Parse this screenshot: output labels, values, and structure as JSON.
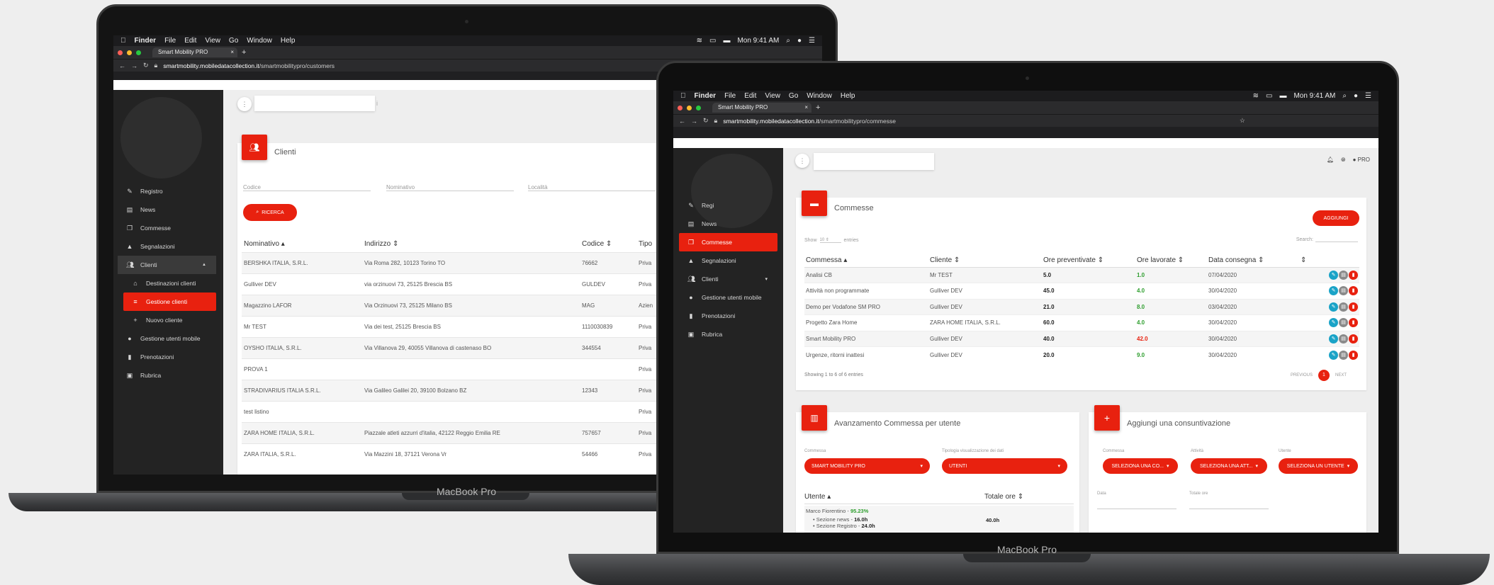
{
  "colors": {
    "accent": "#e8210f",
    "sidebar": "#232323",
    "green": "#2e9e2e"
  },
  "menubar": {
    "apple": "",
    "items": [
      "Finder",
      "File",
      "Edit",
      "View",
      "Go",
      "Window",
      "Help"
    ],
    "clock": "Mon 9:41 AM"
  },
  "browser_tab": {
    "title": "Smart Mobility PRO",
    "close": "×",
    "new_tab": "+"
  },
  "left_laptop": {
    "url_host": "smartmobility.mobiledatacollection.it",
    "url_path": "/smartmobilitypro/customers",
    "brand": "MacBook Pro",
    "search_placeholder_end": "i",
    "sidebar": [
      {
        "label": "Registro",
        "icon": "user-edit-icon"
      },
      {
        "label": "News",
        "icon": "document-icon"
      },
      {
        "label": "Commesse",
        "icon": "copy-icon"
      },
      {
        "label": "Segnalazioni",
        "icon": "warning-icon"
      },
      {
        "label": "Clienti",
        "icon": "people-icon",
        "chevron": "▲"
      },
      {
        "label": "Destinazioni clienti",
        "icon": "home-icon"
      },
      {
        "label": "Gestione clienti",
        "icon": "list-icon"
      },
      {
        "label": "Nuovo cliente",
        "icon": "plus-icon"
      },
      {
        "label": "Gestione utenti mobile",
        "icon": "person-icon"
      },
      {
        "label": "Prenotazioni",
        "icon": "book-icon"
      },
      {
        "label": "Rubrica",
        "icon": "contacts-icon"
      }
    ],
    "page_title": "Clienti",
    "filters": {
      "codice": "Codice",
      "nominativo": "Nominativo",
      "localita": "Località"
    },
    "search_button": "RICERCA",
    "table_headers": [
      "Nominativo ▴",
      "Indirizzo ⇕",
      "Codice ⇕",
      "Tipo"
    ],
    "rows": [
      [
        "BERSHKA ITALIA, S.R.L.",
        "Via Roma 282, 10123 Torino TO",
        "76662",
        "Priva"
      ],
      [
        "Gulliver DEV",
        "via orzinuovi 73, 25125 Brescia BS",
        "GULDEV",
        "Priva"
      ],
      [
        "Magazzino LAFOR",
        "Via Orzinuovi 73, 25125 Milano BS",
        "MAG",
        "Azien"
      ],
      [
        "Mr TEST",
        "Via dei test, 25125 Brescia BS",
        "1110030839",
        "Priva"
      ],
      [
        "OYSHO ITALIA, S.R.L.",
        "Via Villanova 29, 40055 Villanova di castenaso BO",
        "344554",
        "Priva"
      ],
      [
        "PROVA 1",
        "",
        "",
        "Priva"
      ],
      [
        "STRADIVARIUS ITALIA S.R.L.",
        "Via Galileo Galilei 20, 39100 Bolzano BZ",
        "12343",
        "Priva"
      ],
      [
        "test listino",
        "",
        "",
        "Priva"
      ],
      [
        "ZARA HOME ITALIA, S.R.L.",
        "Piazzale atleti azzurri d'italia, 42122 Reggio Emilia RE",
        "757657",
        "Priva"
      ],
      [
        "ZARA ITALIA, S.R.L.",
        "Via Mazzini 18, 37121 Verona Vr",
        "54466",
        "Priva"
      ]
    ]
  },
  "right_laptop": {
    "url_host": "smartmobility.mobiledatacollection.it",
    "url_path": "/smartmobilitypro/commesse",
    "brand": "MacBook Pro",
    "top_right_user": "PRO",
    "sidebar": [
      {
        "label": "Registro",
        "icon": "user-edit-icon"
      },
      {
        "label": "News",
        "icon": "document-icon"
      },
      {
        "label": "Commesse",
        "icon": "copy-icon"
      },
      {
        "label": "Segnalazioni",
        "icon": "warning-icon"
      },
      {
        "label": "Clienti",
        "icon": "people-icon",
        "chevron": "▾"
      },
      {
        "label": "Gestione utenti mobile",
        "icon": "person-icon"
      },
      {
        "label": "Prenotazioni",
        "icon": "book-icon"
      },
      {
        "label": "Rubrica",
        "icon": "contacts-icon"
      }
    ],
    "sidebar_registro_visible": "Regi",
    "page_title": "Commesse",
    "add_button": "AGGIUNGI",
    "show_label": "Show",
    "show_value": "10",
    "entries_label": "entries",
    "search_label": "Search:",
    "table_headers": [
      "Commessa ▴",
      "Cliente ⇕",
      "Ore preventivate ⇕",
      "Ore lavorate ⇕",
      "Data consegna ⇕",
      "⇕"
    ],
    "rows": [
      {
        "commessa": "Analisi CB",
        "cliente": "Mr TEST",
        "prev": "5.0",
        "lav": "1.0",
        "lav_color": "green",
        "data": "07/04/2020"
      },
      {
        "commessa": "Attività non programmate",
        "cliente": "Gulliver DEV",
        "prev": "45.0",
        "lav": "4.0",
        "lav_color": "green",
        "data": "30/04/2020"
      },
      {
        "commessa": "Demo per Vodafone SM PRO",
        "cliente": "Gulliver DEV",
        "prev": "21.0",
        "lav": "8.0",
        "lav_color": "green",
        "data": "03/04/2020"
      },
      {
        "commessa": "Progetto Zara Home",
        "cliente": "ZARA HOME ITALIA, S.R.L.",
        "prev": "60.0",
        "lav": "4.0",
        "lav_color": "green",
        "data": "30/04/2020"
      },
      {
        "commessa": "Smart Mobility PRO",
        "cliente": "Gulliver DEV",
        "prev": "40.0",
        "lav": "42.0",
        "lav_color": "red",
        "data": "30/04/2020"
      },
      {
        "commessa": "Urgenze, ritorni inattesi",
        "cliente": "Gulliver DEV",
        "prev": "20.0",
        "lav": "9.0",
        "lav_color": "green",
        "data": "30/04/2020"
      }
    ],
    "showing_text": "Showing 1 to 6 of 6 entries",
    "pagination": {
      "previous": "PREVIOUS",
      "page": "1",
      "next": "NEXT"
    },
    "avanzamento": {
      "title": "Avanzamento Commessa per utente",
      "commessa_label": "Commessa",
      "commessa_value": "SMART MOBILITY PRO",
      "tipologia_label": "Tipologia visualizzazione dei dati",
      "tipologia_value": "UTENTI",
      "headers": [
        "Utente ▴",
        "Totale ore ⇕"
      ],
      "user_name": "Marco Fiorentino",
      "user_pct": "95.23%",
      "lines": [
        {
          "label": "Sezione news",
          "value": "16.0h"
        },
        {
          "label": "Sezione Registro",
          "value": "24.0h"
        }
      ],
      "total": "40.0h"
    },
    "consuntivo": {
      "title": "Aggiungi una consuntivazione",
      "commessa_label": "Commessa",
      "commessa_value": "SELEZIONA UNA CO...",
      "attivita_label": "Attività",
      "attivita_value": "SELEZIONA UNA ATT...",
      "utente_label": "Utente",
      "utente_value": "SELEZIONA UN UTENTE",
      "data_label": "Data",
      "ore_label": "Totale ore"
    }
  }
}
